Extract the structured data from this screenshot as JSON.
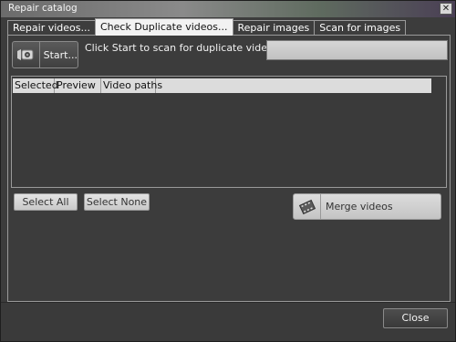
{
  "window": {
    "title": "Repair catalog",
    "close_glyph": "✕"
  },
  "tabs": [
    {
      "label": "Repair videos...",
      "active": false
    },
    {
      "label": "Check Duplicate videos...",
      "active": true
    },
    {
      "label": "Repair images",
      "active": false
    },
    {
      "label": "Scan for images",
      "active": false
    }
  ],
  "scan": {
    "start_label": "Start...",
    "start_icon": "camera-icon",
    "hint": "Click Start to scan for duplicate videos...",
    "progress": 0
  },
  "list": {
    "columns": [
      "Selected",
      "Preview",
      "Video paths"
    ]
  },
  "actions": {
    "select_all": "Select All",
    "select_none": "Select None",
    "merge_label": "Merge videos",
    "merge_icon": "film-icon"
  },
  "footer": {
    "close_label": "Close"
  }
}
